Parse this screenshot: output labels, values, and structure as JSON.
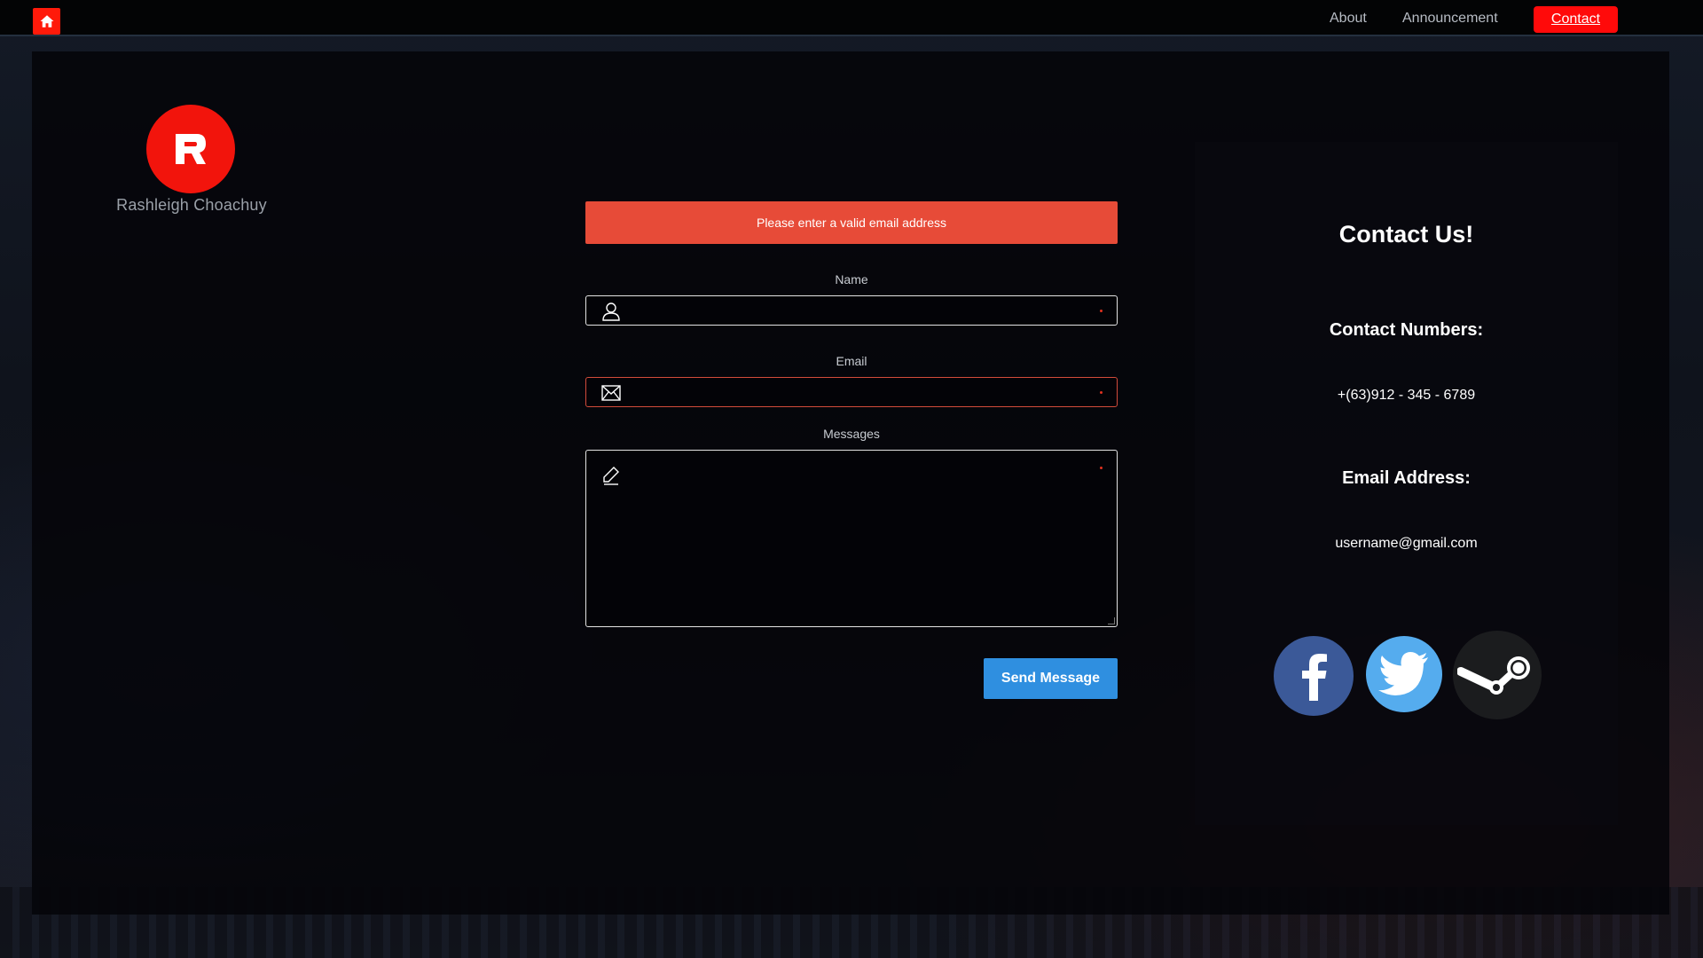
{
  "navbar": {
    "home_icon": "home-icon",
    "links": [
      "About",
      "Announcement"
    ],
    "active_link": "Contact"
  },
  "brand": {
    "name": "Rashleigh Choachuy",
    "logo_letter": "R",
    "logo_color": "#f2140c"
  },
  "form": {
    "alert": "Please enter a valid email address",
    "name_label": "Name",
    "email_label": "Email",
    "messages_label": "Messages",
    "name_value": "",
    "email_value": "",
    "messages_value": "",
    "submit_label": "Send Message",
    "alert_color": "#e74b38",
    "button_color": "#2f8fe0"
  },
  "contact": {
    "title": "Contact Us!",
    "numbers_heading": "Contact Numbers:",
    "phone": "+(63)912 - 345 - 6789",
    "email_heading": "Email Address:",
    "email": "username@gmail.com",
    "socials": [
      "facebook-icon",
      "twitter-icon",
      "steam-icon"
    ]
  }
}
